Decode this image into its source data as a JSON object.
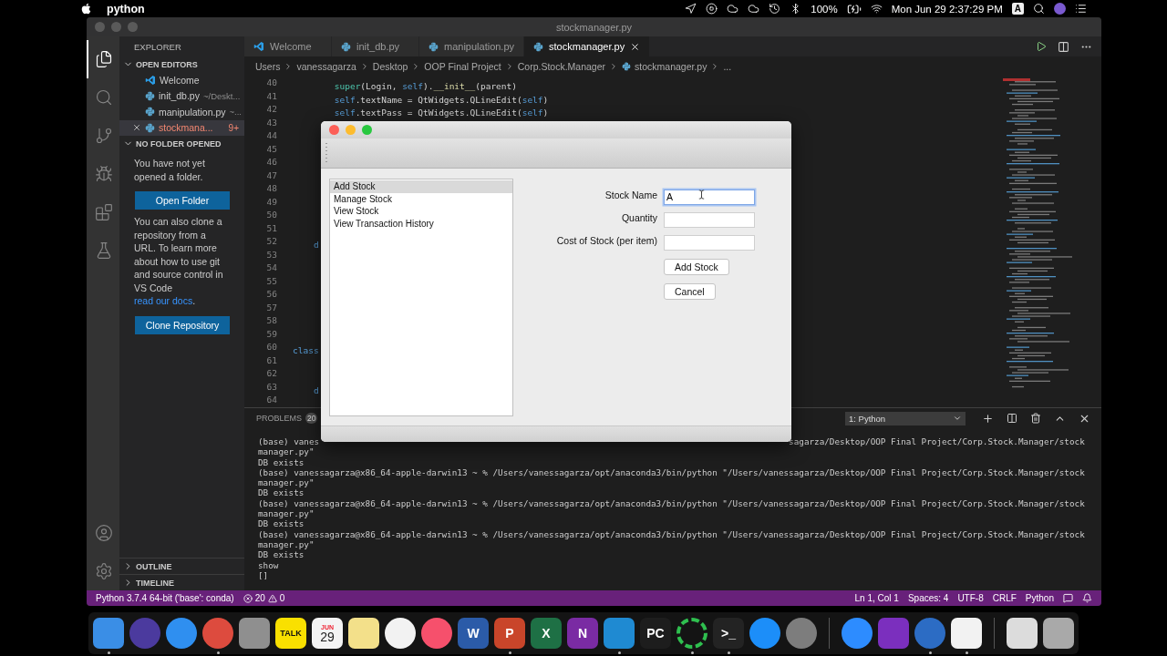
{
  "menubar": {
    "app": "python",
    "battery": "100%",
    "clock": "Mon Jun 29  2:37:29 PM",
    "input_source": "A"
  },
  "window": {
    "title": "stockmanager.py"
  },
  "activity": [
    {
      "kind": "files",
      "selected": true
    },
    {
      "kind": "search",
      "selected": false
    },
    {
      "kind": "source-control",
      "selected": false
    },
    {
      "kind": "run",
      "selected": false
    },
    {
      "kind": "extensions",
      "selected": false
    },
    {
      "kind": "testing",
      "selected": false
    }
  ],
  "explorer": {
    "title": "EXPLORER",
    "open_editors": {
      "title": "OPEN EDITORS",
      "expanded": true,
      "items": [
        {
          "kind": "welcome",
          "name": "Welcome",
          "selected": false,
          "has_problems": false
        },
        {
          "kind": "python",
          "name": "init_db.py",
          "path": "~/Deskt...",
          "selected": false,
          "has_problems": false
        },
        {
          "kind": "python",
          "name": "manipulation.py",
          "path": "~...",
          "selected": false,
          "has_problems": false
        },
        {
          "kind": "python",
          "name": "stockmana...",
          "badge": "9+",
          "selected": true,
          "has_problems": true
        }
      ]
    },
    "no_folder": {
      "title": "NO FOLDER OPENED",
      "expanded": true,
      "message": "You have not yet opened a folder.",
      "open_button": "Open Folder",
      "clone_text": "You can also clone a repository from a URL. To learn more about how to use git and source control in VS Code ",
      "clone_link": "read our docs",
      "clone_end": ".",
      "clone_button": "Clone Repository"
    },
    "footer_sections": [
      {
        "title": "OUTLINE",
        "expanded": false
      },
      {
        "title": "TIMELINE",
        "expanded": false
      }
    ]
  },
  "tabs": [
    {
      "kind": "welcome",
      "label": "Welcome",
      "selected": false
    },
    {
      "kind": "python",
      "label": "init_db.py",
      "selected": false
    },
    {
      "kind": "python",
      "label": "manipulation.py",
      "selected": false
    },
    {
      "kind": "python",
      "label": "stockmanager.py",
      "selected": true
    }
  ],
  "breadcrumb": [
    "Users",
    "vanessagarza",
    "Desktop",
    "OOP Final Project",
    "Corp.Stock.Manager",
    "stockmanager.py",
    "..."
  ],
  "code_lines": [
    {
      "number": "40",
      "tokens": [
        {
          "text": "        super",
          "kind": "builtin"
        },
        {
          "text": "(Login, ",
          "kind": "plain"
        },
        {
          "text": "self",
          "kind": "self"
        },
        {
          "text": ").",
          "kind": "plain"
        },
        {
          "text": "__init__",
          "kind": "func"
        },
        {
          "text": "(parent)",
          "kind": "plain"
        }
      ]
    },
    {
      "number": "41",
      "tokens": [
        {
          "text": "        self",
          "kind": "self"
        },
        {
          "text": ".textName = QtWidgets.QLineEdit(",
          "kind": "plain"
        },
        {
          "text": "self",
          "kind": "self"
        },
        {
          "text": ")",
          "kind": "plain"
        }
      ]
    },
    {
      "number": "42",
      "tokens": [
        {
          "text": "        self",
          "kind": "self"
        },
        {
          "text": ".textPass = QtWidgets.QLineEdit(",
          "kind": "plain"
        },
        {
          "text": "self",
          "kind": "self"
        },
        {
          "text": ")",
          "kind": "plain"
        }
      ]
    },
    {
      "number": "43"
    },
    {
      "number": "44"
    },
    {
      "number": "45"
    },
    {
      "number": "46"
    },
    {
      "number": "47"
    },
    {
      "number": "48"
    },
    {
      "number": "49"
    },
    {
      "number": "50"
    },
    {
      "number": "51"
    },
    {
      "number": "52",
      "tokens": [
        {
          "text": "    d",
          "kind": "keyword"
        }
      ]
    },
    {
      "number": "53"
    },
    {
      "number": "54"
    },
    {
      "number": "55"
    },
    {
      "number": "56"
    },
    {
      "number": "57"
    },
    {
      "number": "58"
    },
    {
      "number": "59"
    },
    {
      "number": "60",
      "tokens": [
        {
          "text": "class",
          "kind": "keyword"
        }
      ]
    },
    {
      "number": "61"
    },
    {
      "number": "62"
    },
    {
      "number": "63",
      "tokens": [
        {
          "text": "    d",
          "kind": "keyword"
        }
      ]
    },
    {
      "number": "64"
    }
  ],
  "panel": {
    "tab": "PROBLEMS",
    "count": "20",
    "terminal_select": "1: Python",
    "lines": [
      {
        "left": "(base) vanes",
        "right": "sagarza/Desktop/OOP Final Project/Corp.Stock.Manager/stock"
      },
      {
        "text": "manager.py\""
      },
      {
        "text": "DB exists"
      },
      {
        "text": "(base) vanessagarza@x86_64-apple-darwin13 ~ % /Users/vanessagarza/opt/anaconda3/bin/python \"/Users/vanessagarza/Desktop/OOP Final Project/Corp.Stock.Manager/stock"
      },
      {
        "text": "manager.py\""
      },
      {
        "text": "DB exists"
      },
      {
        "text": "(base) vanessagarza@x86_64-apple-darwin13 ~ % /Users/vanessagarza/opt/anaconda3/bin/python \"/Users/vanessagarza/Desktop/OOP Final Project/Corp.Stock.Manager/stock"
      },
      {
        "text": "manager.py\""
      },
      {
        "text": "DB exists"
      },
      {
        "text": "(base) vanessagarza@x86_64-apple-darwin13 ~ % /Users/vanessagarza/opt/anaconda3/bin/python \"/Users/vanessagarza/Desktop/OOP Final Project/Corp.Stock.Manager/stock"
      },
      {
        "text": "manager.py\""
      },
      {
        "text": "DB exists"
      },
      {
        "text": "show"
      },
      {
        "text": "[]"
      }
    ]
  },
  "status_bar": {
    "interpreter": "Python 3.7.4 64-bit ('base': conda)",
    "errors": "20",
    "warnings": "0",
    "items": [
      "Ln 1, Col 1",
      "Spaces: 4",
      "UTF-8",
      "CRLF",
      "Python"
    ]
  },
  "dialog": {
    "list": [
      {
        "label": "Add Stock",
        "selected": true
      },
      {
        "label": "Manage Stock",
        "selected": false
      },
      {
        "label": "View Stock",
        "selected": false
      },
      {
        "label": "View Transaction History",
        "selected": false
      }
    ],
    "fields": [
      {
        "label": "Stock Name",
        "value": "A",
        "focused": true
      },
      {
        "label": "Quantity",
        "focused": false
      },
      {
        "label": "Cost of Stock (per item)",
        "focused": false
      }
    ],
    "buttons": [
      "Add Stock",
      "Cancel"
    ]
  },
  "dock": [
    {
      "kind": "tile",
      "color": "#3a8ee6",
      "running": true
    },
    {
      "kind": "round",
      "color": "#4b3a9e",
      "running": false
    },
    {
      "kind": "round",
      "color": "#2f8ff0",
      "running": false
    },
    {
      "kind": "round",
      "color": "#dd4b3e",
      "running": true
    },
    {
      "kind": "tile",
      "color": "#8f8f8f",
      "running": false
    },
    {
      "kind": "tile",
      "color": "#f9e000",
      "label": "TALK",
      "running": false
    },
    {
      "kind": "calendar",
      "color": "#f4f4f4",
      "label": "JUN",
      "sublabel": "29",
      "running": false
    },
    {
      "kind": "tile",
      "color": "#f3e08a",
      "running": false
    },
    {
      "kind": "round",
      "color": "#f2f2f2",
      "running": false
    },
    {
      "kind": "round",
      "color": "#f6506c",
      "running": false
    },
    {
      "kind": "tile",
      "color": "#2b5ba8",
      "label": "W",
      "running": false
    },
    {
      "kind": "tile",
      "color": "#c9452a",
      "label": "P",
      "running": true
    },
    {
      "kind": "tile",
      "color": "#1e7045",
      "label": "X",
      "running": false
    },
    {
      "kind": "tile",
      "color": "#7a2ba3",
      "label": "N",
      "running": false
    },
    {
      "kind": "tile",
      "color": "#1f8ad2",
      "running": true
    },
    {
      "kind": "tile",
      "color": "#1d1d1d",
      "label": "PC",
      "running": false
    },
    {
      "kind": "ring",
      "color": "#2fbf4f",
      "running": true
    },
    {
      "kind": "tile",
      "color": "#232323",
      "label": ">_",
      "running": true
    },
    {
      "kind": "round",
      "color": "#1c8ef9",
      "running": false
    },
    {
      "kind": "round",
      "color": "#7d7d7d",
      "running": false
    },
    {
      "kind": "separator"
    },
    {
      "kind": "round",
      "color": "#2d8cff",
      "running": false
    },
    {
      "kind": "tile",
      "color": "#7b2fbe",
      "running": false
    },
    {
      "kind": "round",
      "color": "#2c6cc4",
      "running": true
    },
    {
      "kind": "tile",
      "color": "#f2f2f2",
      "running": true
    },
    {
      "kind": "separator"
    },
    {
      "kind": "tile",
      "color": "#dcdcdc",
      "running": false
    },
    {
      "kind": "tile",
      "color": "#a9a9a9",
      "running": false
    }
  ]
}
